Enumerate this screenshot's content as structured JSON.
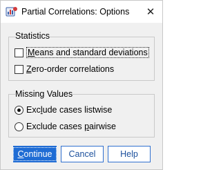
{
  "window": {
    "title": "Partial Correlations: Options",
    "close_symbol": "✕",
    "app_icon": "spss-app-icon"
  },
  "statistics": {
    "title": "Statistics",
    "means": {
      "accel": "M",
      "rest": "eans and standard deviations",
      "checked": false
    },
    "zero_order": {
      "accel": "Z",
      "rest": "ero-order correlations",
      "checked": false
    }
  },
  "missing_values": {
    "title": "Missing Values",
    "listwise": {
      "pre": "Exc",
      "accel": "l",
      "rest": "ude cases listwise",
      "selected": true
    },
    "pairwise": {
      "pre": "Exclude cases ",
      "accel": "p",
      "rest": "airwise",
      "selected": false
    }
  },
  "buttons": {
    "continue": {
      "accel": "C",
      "rest": "ontinue"
    },
    "cancel": "Cancel",
    "help": "Help"
  },
  "colors": {
    "primary_button": "#1f6cd4",
    "button_border": "#2f6fcf",
    "dialog_background": "#f0f0f0"
  }
}
